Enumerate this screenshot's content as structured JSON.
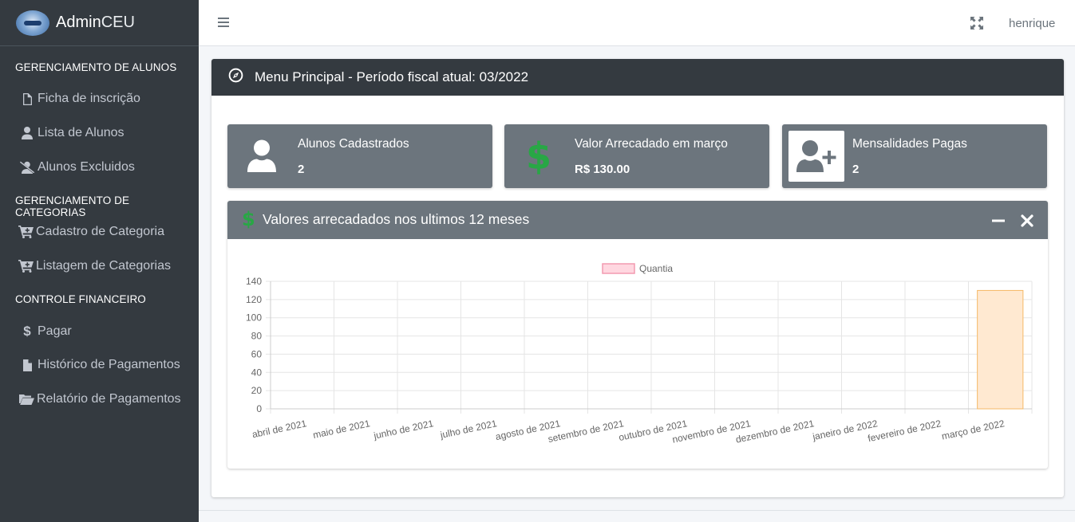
{
  "brand": {
    "bold": "Admin",
    "light": "CEU"
  },
  "sidebar": {
    "sections": [
      {
        "header": "GERENCIAMENTO DE ALUNOS",
        "items": [
          {
            "label": "Ficha de inscrição",
            "icon": "file-icon"
          },
          {
            "label": "Lista de Alunos",
            "icon": "user-icon"
          },
          {
            "label": "Alunos Excluidos",
            "icon": "user-slash-icon"
          }
        ]
      },
      {
        "header": "GERENCIAMENTO DE CATEGORIAS",
        "items": [
          {
            "label": "Cadastro de Categoria",
            "icon": "cart-plus-icon"
          },
          {
            "label": "Listagem de Categorias",
            "icon": "cart-plus-icon"
          }
        ]
      },
      {
        "header": "CONTROLE FINANCEIRO",
        "items": [
          {
            "label": "Pagar",
            "icon": "dollar-icon"
          },
          {
            "label": "Histórico de Pagamentos",
            "icon": "file-icon"
          },
          {
            "label": "Relatório de Pagamentos",
            "icon": "folder-open-icon"
          }
        ]
      }
    ]
  },
  "topbar": {
    "username": "henrique",
    "menu_icon": "bars-icon",
    "fullscreen_icon": "expand-icon"
  },
  "main": {
    "title": "Menu Principal - Período fiscal atual: 03/2022",
    "title_icon": "compass-icon",
    "info_boxes": [
      {
        "label": "Alunos Cadastrados",
        "value": "2",
        "icon": "user-icon"
      },
      {
        "label": "Valor Arrecadado em março",
        "value": "R$ 130.00",
        "icon": "dollar-icon"
      },
      {
        "label": "Mensalidades Pagas",
        "value": "2",
        "icon": "user-plus-icon"
      }
    ],
    "chart_card": {
      "title": "Valores arrecadados nos ultimos 12 meses",
      "icon": "dollar-icon"
    }
  },
  "colors": {
    "sidebar": "#343a40",
    "info_box": "#6c757d",
    "accent_green": "#28a745",
    "bar_fill": "#ffe9d1",
    "bar_border": "#f5b967",
    "legend_fill": "#ffd7e0",
    "legend_border": "#f29ab0"
  },
  "chart_data": {
    "type": "bar",
    "categories": [
      "abril de 2021",
      "maio de 2021",
      "junho de 2021",
      "julho de 2021",
      "agosto de 2021",
      "setembro de 2021",
      "outubro de 2021",
      "novembro de 2021",
      "dezembro de 2021",
      "janeiro de 2022",
      "fevereiro de 2022",
      "março de 2022"
    ],
    "series": [
      {
        "name": "Quantia",
        "values": [
          0,
          0,
          0,
          0,
          0,
          0,
          0,
          0,
          0,
          0,
          0,
          130
        ]
      }
    ],
    "yticks": [
      "0",
      "20",
      "40",
      "60",
      "80",
      "100",
      "120",
      "140"
    ],
    "ylim": [
      0,
      140
    ],
    "grid": true,
    "legend": "top-center"
  }
}
